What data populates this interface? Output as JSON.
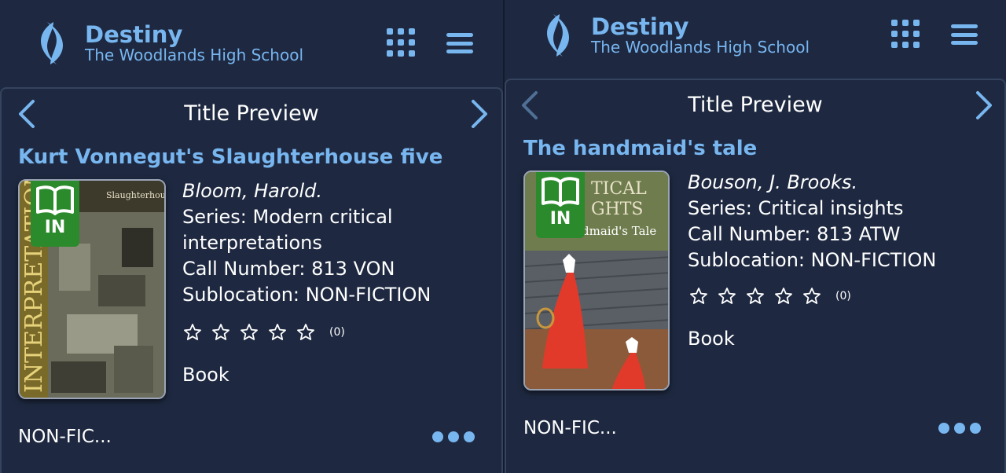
{
  "colors": {
    "background": "#1e2941",
    "accent": "#78b6f0",
    "status_green": "#2b8a2b"
  },
  "left": {
    "app": {
      "title": "Destiny",
      "school": "The Woodlands High School"
    },
    "card": {
      "header": "Title Preview",
      "book_title": "Kurt Vonnegut's Slaughterhouse five",
      "status": "IN",
      "author": "Bloom, Harold.",
      "series_line1": "Series: Modern critical",
      "series_line2": "interpretations",
      "call_number": "Call Number: 813 VON",
      "sublocation": "Sublocation: NON-FICTION",
      "rating_count": "(0)",
      "rating_value": 0,
      "format": "Book",
      "location": "NON-FIC..."
    }
  },
  "right": {
    "app": {
      "title": "Destiny",
      "school": "The Woodlands High School"
    },
    "card": {
      "header": "Title Preview",
      "book_title": "The handmaid's tale",
      "status": "IN",
      "author": "Bouson, J. Brooks.",
      "series": "Series: Critical insights",
      "call_number": "Call Number: 813 ATW",
      "sublocation": "Sublocation: NON-FICTION",
      "rating_count": "(0)",
      "rating_value": 0,
      "format": "Book",
      "location": "NON-FIC..."
    }
  },
  "icons": [
    "destiny-logo-icon",
    "apps-grid-icon",
    "hamburger-menu-icon",
    "chevron-left-icon",
    "chevron-right-icon",
    "open-book-icon",
    "star-outline-icon",
    "more-dots-icon"
  ]
}
